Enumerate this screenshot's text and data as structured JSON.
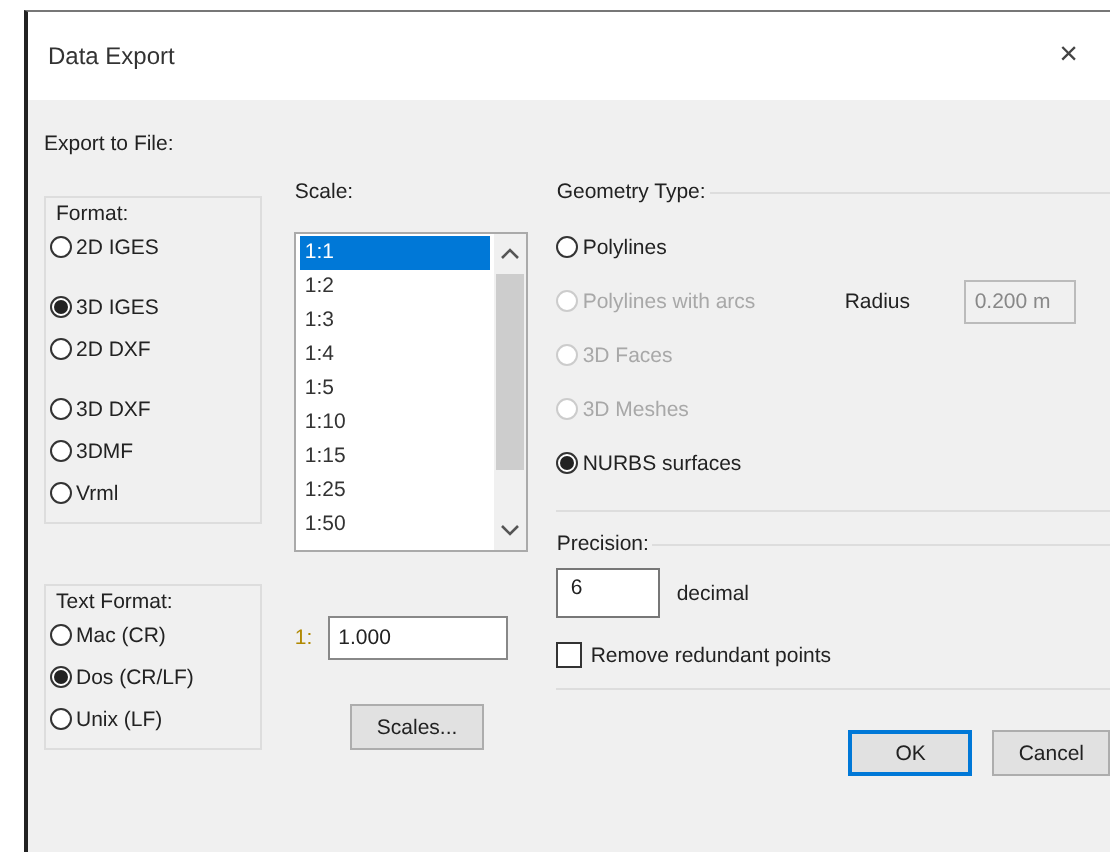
{
  "window": {
    "title": "Data Export",
    "close": "×"
  },
  "export_label": "Export to File:",
  "format": {
    "label": "Format:",
    "options": [
      {
        "label": "2D IGES",
        "selected": false
      },
      {
        "label": "3D IGES",
        "selected": true
      },
      {
        "label": "2D DXF",
        "selected": false
      },
      {
        "label": "3D DXF",
        "selected": false
      },
      {
        "label": "3DMF",
        "selected": false
      },
      {
        "label": "Vrml",
        "selected": false
      }
    ]
  },
  "text_format": {
    "label": "Text Format:",
    "options": [
      {
        "label": "Mac (CR)",
        "selected": false
      },
      {
        "label": "Dos (CR/LF)",
        "selected": true
      },
      {
        "label": "Unix (LF)",
        "selected": false
      }
    ]
  },
  "scale": {
    "label": "Scale:",
    "items": [
      {
        "label": "1:1",
        "selected": true
      },
      {
        "label": "1:2",
        "selected": false
      },
      {
        "label": "1:3",
        "selected": false
      },
      {
        "label": "1:4",
        "selected": false
      },
      {
        "label": "1:5",
        "selected": false
      },
      {
        "label": "1:10",
        "selected": false
      },
      {
        "label": "1:15",
        "selected": false
      },
      {
        "label": "1:25",
        "selected": false
      },
      {
        "label": "1:50",
        "selected": false
      }
    ],
    "ratio_prefix": "1:",
    "ratio_value": "1.000",
    "scales_button": "Scales..."
  },
  "geometry": {
    "label": "Geometry Type:",
    "options": [
      {
        "label": "Polylines",
        "selected": false,
        "disabled": false
      },
      {
        "label": "Polylines with arcs",
        "selected": false,
        "disabled": true
      },
      {
        "label": "3D Faces",
        "selected": false,
        "disabled": true
      },
      {
        "label": "3D Meshes",
        "selected": false,
        "disabled": true
      },
      {
        "label": "NURBS surfaces",
        "selected": true,
        "disabled": false
      }
    ],
    "radius": {
      "label": "Radius",
      "value": "0.200 m",
      "disabled": true
    }
  },
  "precision": {
    "label": "Precision:",
    "value": "6",
    "unit": "decimal"
  },
  "remove_redundant": {
    "label": "Remove redundant points",
    "checked": false
  },
  "buttons": [
    {
      "label": "OK",
      "default": true
    },
    {
      "label": "Cancel",
      "default": false
    }
  ]
}
